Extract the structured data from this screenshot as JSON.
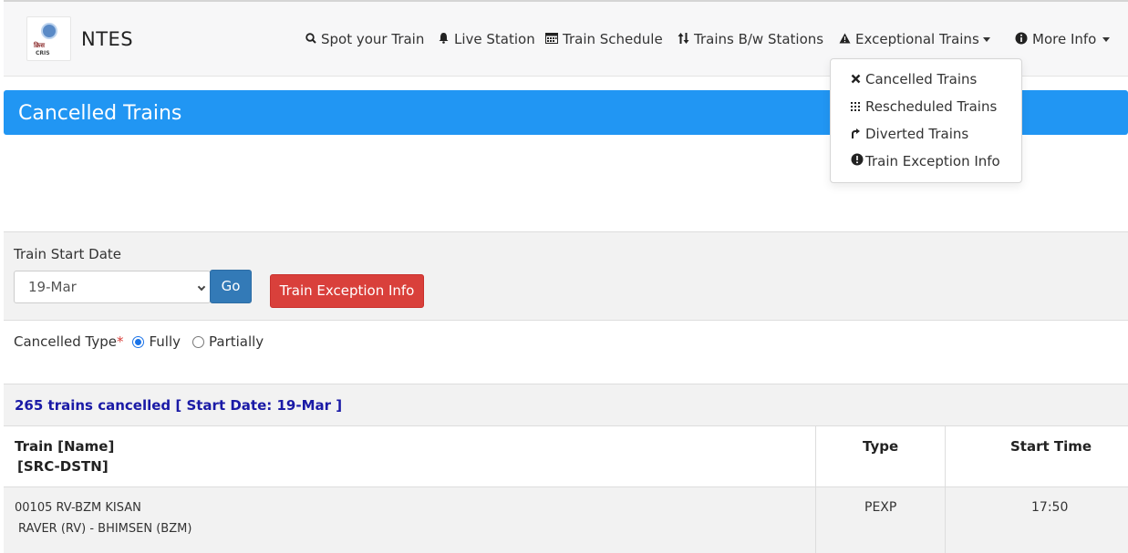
{
  "brand": {
    "name": "NTES",
    "logo_line1": "क्रिस",
    "logo_line2": "CRIS"
  },
  "nav": {
    "spot_train": "Spot your Train",
    "live_station": "Live Station",
    "train_schedule": "Train Schedule",
    "trains_between": "Trains B/w Stations",
    "exceptional_trains": "Exceptional Trains",
    "more_info": "More Info"
  },
  "dropdown": {
    "items": [
      {
        "label": "Cancelled Trains",
        "icon": "x-icon"
      },
      {
        "label": "Rescheduled Trains",
        "icon": "grid-icon"
      },
      {
        "label": "Diverted Trains",
        "icon": "diverted-arrow-icon"
      },
      {
        "label": "Train Exception Info",
        "icon": "exclamation-circle-icon"
      }
    ]
  },
  "page": {
    "title": "Cancelled Trains"
  },
  "form": {
    "start_date_label": "Train Start Date",
    "start_date_value": "19-Mar",
    "go_label": "Go",
    "exception_info_label": "Train Exception Info",
    "cancelled_type_label": "Cancelled Type",
    "required_mark": "*",
    "option_fully": "Fully",
    "option_partially": "Partially",
    "selected_option": "Fully"
  },
  "results": {
    "summary": "265 trains cancelled [ Start Date: 19-Mar ]",
    "headers": {
      "train_line1": "Train [Name]",
      "train_line2": "[SRC-DSTN]",
      "type": "Type",
      "start_time": "Start Time"
    },
    "rows": [
      {
        "train": "00105 RV-BZM KISAN",
        "route": "RAVER (RV) - BHIMSEN (BZM)",
        "type": "PEXP",
        "start_time": "17:50"
      }
    ]
  },
  "colors": {
    "banner": "#2196f3",
    "go_button": "#337ab7",
    "exception_button": "#d9403b",
    "summary_text": "#1a1aa6"
  }
}
